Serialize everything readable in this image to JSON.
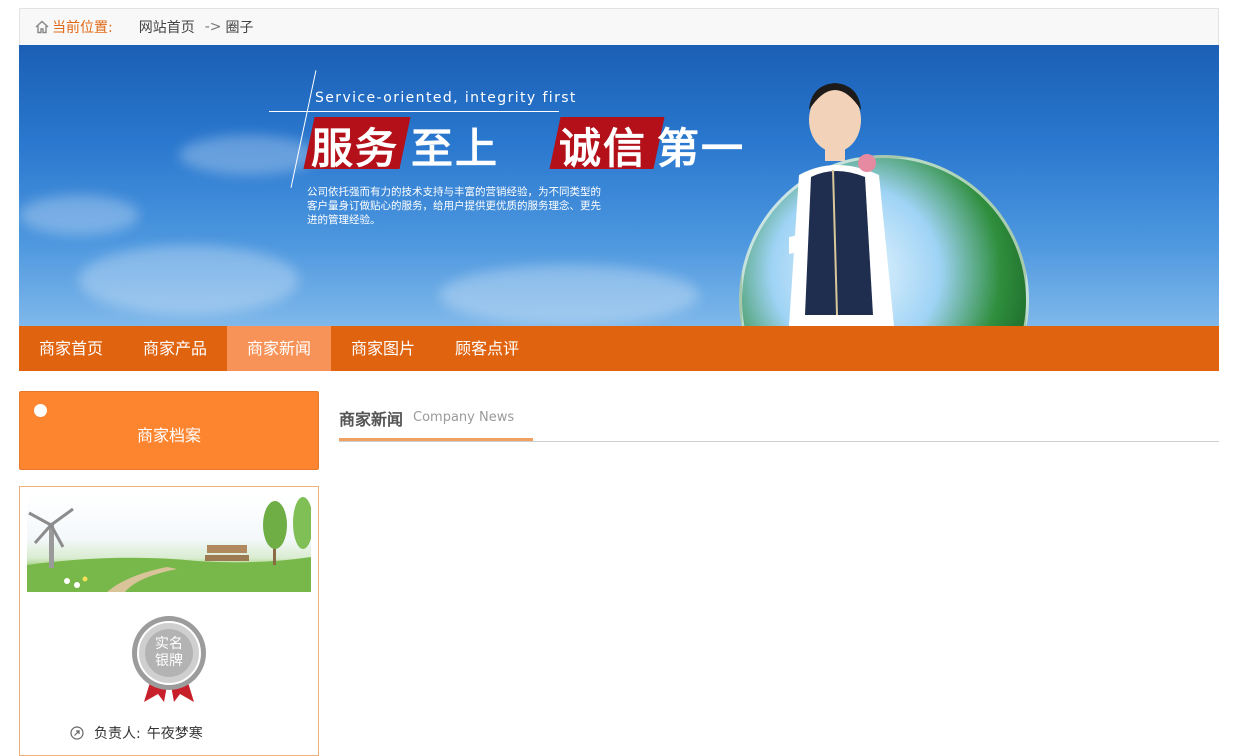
{
  "breadcrumb": {
    "location_label": "当前位置:",
    "items": [
      "网站首页",
      "圈子"
    ],
    "separator": "->"
  },
  "banner": {
    "slogan_en": "Service-oriented, integrity first",
    "slogan_cn_1a": "服务",
    "slogan_cn_1b": "至上",
    "slogan_cn_2a": "诚信",
    "slogan_cn_2b": "第一",
    "description": "公司依托强而有力的技术支持与丰富的营销经验，为不同类型的客户量身订做贴心的服务，给用户提供更优质的服务理念、更先进的管理经验。"
  },
  "nav": {
    "items": [
      {
        "label": "商家首页",
        "active": false
      },
      {
        "label": "商家产品",
        "active": false
      },
      {
        "label": "商家新闻",
        "active": true
      },
      {
        "label": "商家图片",
        "active": false
      },
      {
        "label": "顾客点评",
        "active": false
      }
    ]
  },
  "sidebar": {
    "profile_tab_label": "商家档案",
    "badge_text": "实名银牌",
    "owner_label": "负责人:",
    "owner_name": "午夜梦寒"
  },
  "main": {
    "section_title": "商家新闻",
    "section_subtitle": "Company News"
  },
  "colors": {
    "accent": "#e06410",
    "active_tab": "#f79358",
    "profile_tab": "#fd8530"
  }
}
